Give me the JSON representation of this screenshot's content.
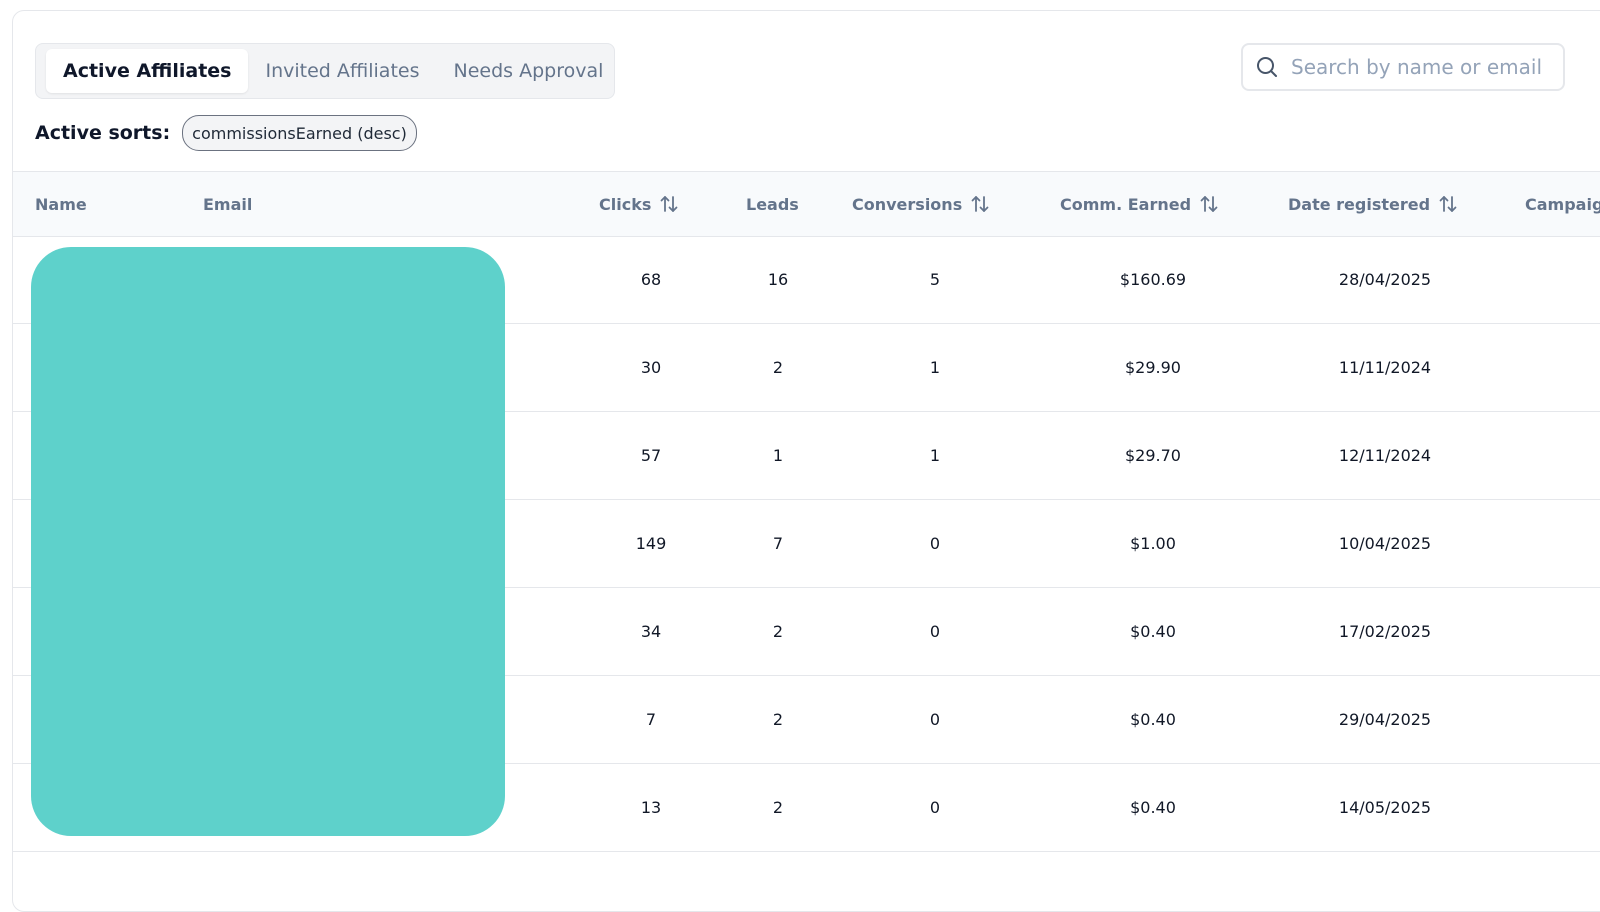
{
  "tabs": [
    {
      "label": "Active Affiliates",
      "active": true
    },
    {
      "label": "Invited Affiliates",
      "active": false
    },
    {
      "label": "Needs Approval",
      "active": false
    }
  ],
  "sorts": {
    "label": "Active sorts:",
    "chip": "commissionsEarned (desc)"
  },
  "search": {
    "placeholder": "Search by name or email",
    "icon": "search-icon"
  },
  "table": {
    "headers": {
      "name": "Name",
      "email": "Email",
      "clicks": "Clicks",
      "leads": "Leads",
      "conversions": "Conversions",
      "comm_earned": "Comm. Earned",
      "date_registered": "Date registered",
      "campaign": "Campaign"
    },
    "rows": [
      {
        "clicks": "68",
        "leads": "16",
        "conversions": "5",
        "comm_earned": "$160.69",
        "date_registered": "28/04/2025"
      },
      {
        "clicks": "30",
        "leads": "2",
        "conversions": "1",
        "comm_earned": "$29.90",
        "date_registered": "11/11/2024"
      },
      {
        "clicks": "57",
        "leads": "1",
        "conversions": "1",
        "comm_earned": "$29.70",
        "date_registered": "12/11/2024"
      },
      {
        "clicks": "149",
        "leads": "7",
        "conversions": "0",
        "comm_earned": "$1.00",
        "date_registered": "10/04/2025"
      },
      {
        "clicks": "34",
        "leads": "2",
        "conversions": "0",
        "comm_earned": "$0.40",
        "date_registered": "17/02/2025"
      },
      {
        "clicks": "7",
        "leads": "2",
        "conversions": "0",
        "comm_earned": "$0.40",
        "date_registered": "29/04/2025"
      },
      {
        "clicks": "13",
        "leads": "2",
        "conversions": "0",
        "comm_earned": "$0.40",
        "date_registered": "14/05/2025"
      }
    ]
  },
  "colors": {
    "redaction": "#5ed1cb",
    "header_bg": "#f8fafc",
    "muted_text": "#64748b"
  }
}
